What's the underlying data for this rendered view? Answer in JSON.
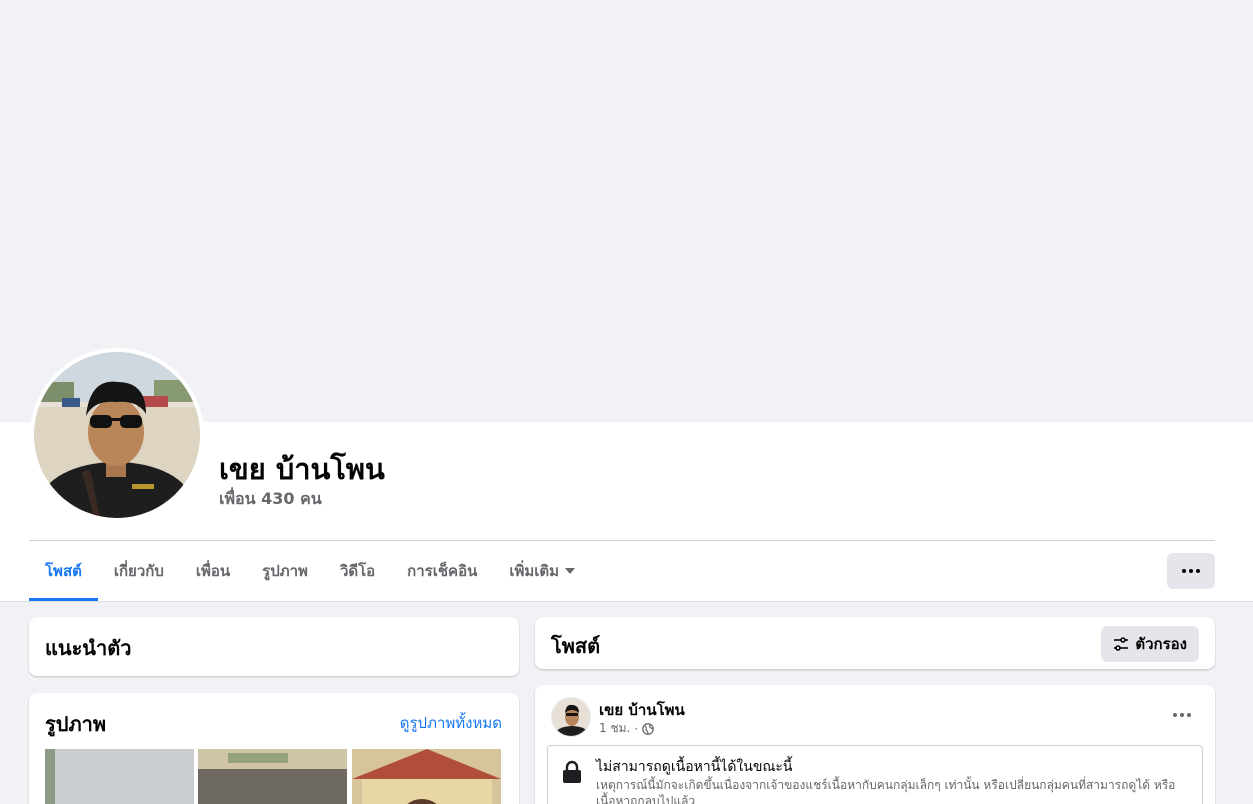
{
  "profile": {
    "name": "เขย บ้านโพน",
    "friends": "เพื่อน 430 คน"
  },
  "tabs": [
    {
      "label": "โพสต์",
      "active": true
    },
    {
      "label": "เกี่ยวกับ"
    },
    {
      "label": "เพื่อน"
    },
    {
      "label": "รูปภาพ"
    },
    {
      "label": "วิดีโอ"
    },
    {
      "label": "การเช็คอิน"
    },
    {
      "label": "เพิ่มเติม"
    }
  ],
  "left": {
    "intro_title": "แนะนำตัว",
    "photos_title": "รูปภาพ",
    "photos_see_all": "ดูรูปภาพทั้งหมด"
  },
  "posts": {
    "title": "โพสต์",
    "filter_label": "ตัวกรอง",
    "items": [
      {
        "author": "เขย บ้านโพน",
        "time": "1 ชม.",
        "notice_title": "ไม่สามารถดูเนื้อหานี้ได้ในขณะนี้",
        "notice_body": "เหตุการณ์นี้มักจะเกิดขึ้นเนื่องจากเจ้าของแชร์เนื้อหากับคนกลุ่มเล็กๆ เท่านั้น หรือเปลี่ยนกลุ่มคนที่สามารถดูได้ หรือเนื้อหาถูกลบไปแล้ว"
      }
    ]
  },
  "colors": {
    "accent": "#1877f2",
    "secondary_text": "#65676b",
    "background": "#f0f2f5"
  }
}
